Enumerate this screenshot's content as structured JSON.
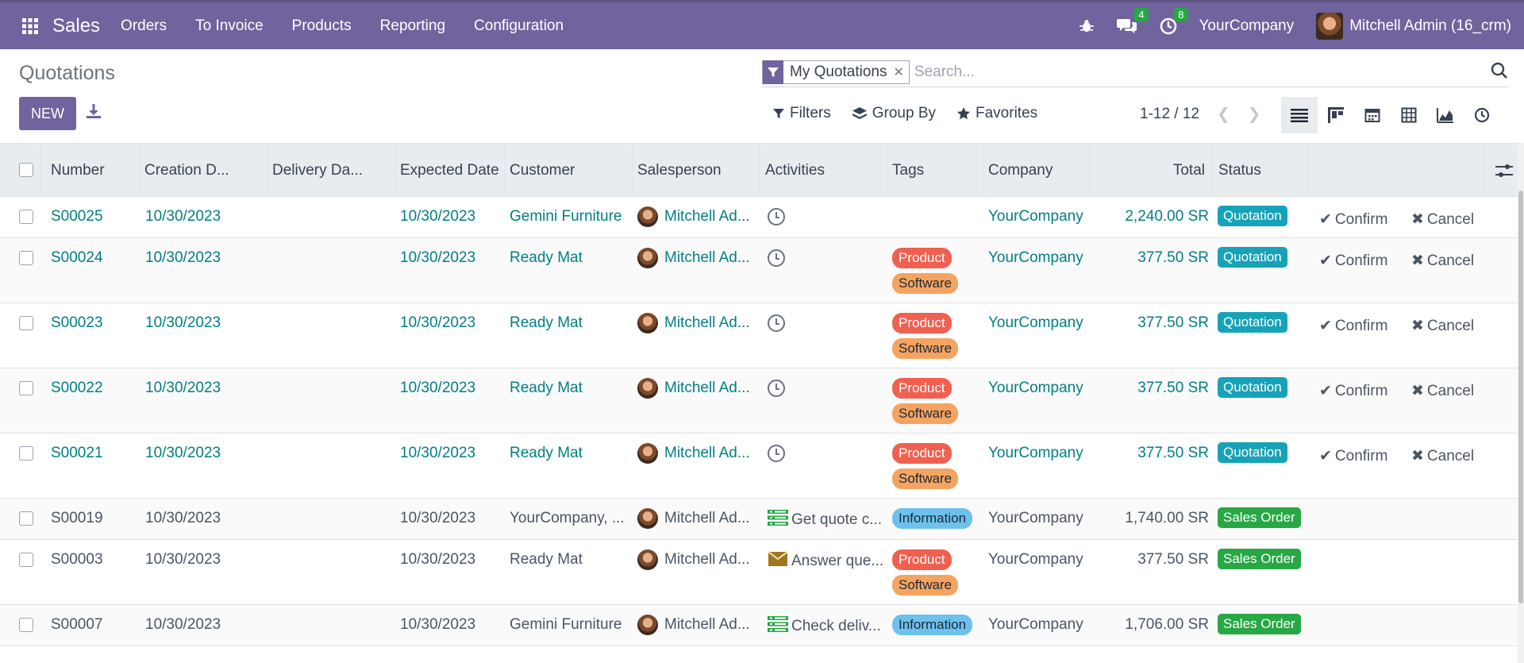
{
  "app": {
    "name": "Sales",
    "menu": [
      "Orders",
      "To Invoice",
      "Products",
      "Reporting",
      "Configuration"
    ]
  },
  "systray": {
    "messages_count": "4",
    "activities_count": "8",
    "company": "YourCompany",
    "user": "Mitchell Admin (16_crm)"
  },
  "page": {
    "title": "Quotations",
    "new_label": "NEW"
  },
  "search": {
    "facet": "My Quotations",
    "placeholder": "Search..."
  },
  "toolbar": {
    "filters": "Filters",
    "group_by": "Group By",
    "favorites": "Favorites",
    "pager": "1-12 / 12"
  },
  "colors": {
    "brand": "#71639e",
    "link": "#017e84",
    "quotation_status": "#17a2b8",
    "sales_order_status": "#28a745",
    "tag_product": "#f06050",
    "tag_software": "#f4a460",
    "tag_information": "#6cc1ed"
  },
  "table": {
    "columns": [
      "Number",
      "Creation D...",
      "Delivery Da...",
      "Expected Date",
      "Customer",
      "Salesperson",
      "Activities",
      "Tags",
      "Company",
      "Total",
      "Status"
    ],
    "confirm_label": "Confirm",
    "cancel_label": "Cancel",
    "rows": [
      {
        "number": "S00025",
        "created": "10/30/2023",
        "expected": "10/30/2023",
        "customer": "Gemini Furniture",
        "salesperson": "Mitchell Ad...",
        "activity": "",
        "tags": [],
        "company": "YourCompany",
        "total": "2,240.00 SR",
        "status": "Quotation"
      },
      {
        "number": "S00024",
        "created": "10/30/2023",
        "expected": "10/30/2023",
        "customer": "Ready Mat",
        "salesperson": "Mitchell Ad...",
        "activity": "",
        "tags": [
          "Product",
          "Software"
        ],
        "company": "YourCompany",
        "total": "377.50 SR",
        "status": "Quotation"
      },
      {
        "number": "S00023",
        "created": "10/30/2023",
        "expected": "10/30/2023",
        "customer": "Ready Mat",
        "salesperson": "Mitchell Ad...",
        "activity": "",
        "tags": [
          "Product",
          "Software"
        ],
        "company": "YourCompany",
        "total": "377.50 SR",
        "status": "Quotation"
      },
      {
        "number": "S00022",
        "created": "10/30/2023",
        "expected": "10/30/2023",
        "customer": "Ready Mat",
        "salesperson": "Mitchell Ad...",
        "activity": "",
        "tags": [
          "Product",
          "Software"
        ],
        "company": "YourCompany",
        "total": "377.50 SR",
        "status": "Quotation"
      },
      {
        "number": "S00021",
        "created": "10/30/2023",
        "expected": "10/30/2023",
        "customer": "Ready Mat",
        "salesperson": "Mitchell Ad...",
        "activity": "",
        "tags": [
          "Product",
          "Software"
        ],
        "company": "YourCompany",
        "total": "377.50 SR",
        "status": "Quotation"
      },
      {
        "number": "S00019",
        "created": "10/30/2023",
        "expected": "10/30/2023",
        "customer": "YourCompany, ...",
        "salesperson": "Mitchell Ad...",
        "activity": "Get quote c...",
        "activity_icon": "todo-list-icon",
        "tags": [
          "Information"
        ],
        "company": "YourCompany",
        "total": "1,740.00 SR",
        "status": "Sales Order"
      },
      {
        "number": "S00003",
        "created": "10/30/2023",
        "expected": "10/30/2023",
        "customer": "Ready Mat",
        "salesperson": "Mitchell Ad...",
        "activity": "Answer que...",
        "activity_icon": "envelope-icon",
        "tags": [
          "Product",
          "Software"
        ],
        "company": "YourCompany",
        "total": "377.50 SR",
        "status": "Sales Order"
      },
      {
        "number": "S00007",
        "created": "10/30/2023",
        "expected": "10/30/2023",
        "customer": "Gemini Furniture",
        "salesperson": "Mitchell Ad...",
        "activity": "Check deliv...",
        "activity_icon": "todo-list-icon",
        "tags": [
          "Information"
        ],
        "company": "YourCompany",
        "total": "1,706.00 SR",
        "status": "Sales Order"
      }
    ]
  }
}
